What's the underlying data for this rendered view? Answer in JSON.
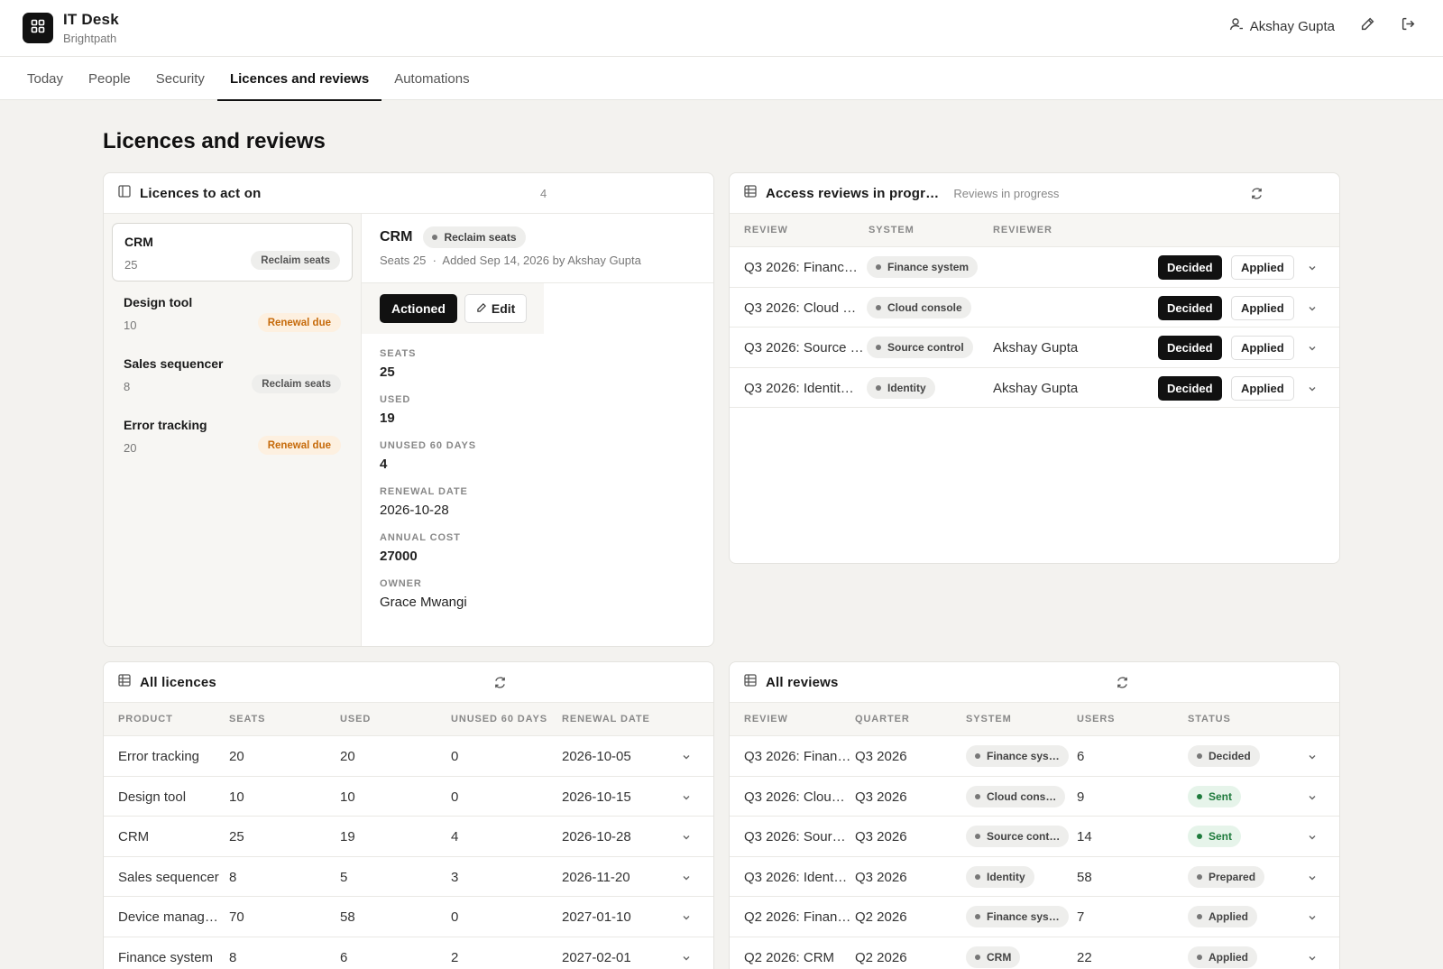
{
  "app": {
    "title": "IT Desk",
    "org": "Brightpath",
    "user": "Akshay Gupta",
    "accent": "#111111"
  },
  "icons": [
    "grid-icon",
    "user-icon",
    "pencil-icon",
    "logout-icon",
    "sidebar-panel-icon",
    "table-icon",
    "refresh-icon",
    "chevron-down-icon"
  ],
  "tabs": [
    "Today",
    "People",
    "Security",
    "Licences and reviews",
    "Automations"
  ],
  "active_tab": "Licences and reviews",
  "page_title": "Licences and reviews",
  "act_on": {
    "title": "Licences to act on",
    "count": "4",
    "items": [
      {
        "name": "CRM",
        "count": "25",
        "badge": "Reclaim seats",
        "tone": "grey"
      },
      {
        "name": "Design tool",
        "count": "10",
        "badge": "Renewal due",
        "tone": "orange"
      },
      {
        "name": "Sales sequencer",
        "count": "8",
        "badge": "Reclaim seats",
        "tone": "grey"
      },
      {
        "name": "Error tracking",
        "count": "20",
        "badge": "Renewal due",
        "tone": "orange"
      }
    ],
    "detail": {
      "name": "CRM",
      "badge": "Reclaim seats",
      "seats_meta": "Seats 25",
      "sep": "·",
      "added_meta": "Added Sep 14, 2026 by Akshay Gupta",
      "actioned_label": "Actioned",
      "edit_label": "Edit",
      "fields": [
        {
          "label": "SEATS",
          "value": "25",
          "strong": true
        },
        {
          "label": "USED",
          "value": "19",
          "strong": true
        },
        {
          "label": "UNUSED 60 DAYS",
          "value": "4",
          "strong": true
        },
        {
          "label": "RENEWAL DATE",
          "value": "2026-10-28",
          "strong": false
        },
        {
          "label": "ANNUAL COST",
          "value": "27000",
          "strong": true
        },
        {
          "label": "OWNER",
          "value": "Grace Mwangi",
          "strong": false
        }
      ]
    }
  },
  "access_reviews": {
    "title": "Access reviews in progr…",
    "subtitle": "Reviews in progress",
    "columns": [
      "REVIEW",
      "SYSTEM",
      "REVIEWER"
    ],
    "decided_label": "Decided",
    "applied_label": "Applied",
    "rows": [
      {
        "review": "Q3 2026: Financ…",
        "system": "Finance system",
        "reviewer": ""
      },
      {
        "review": "Q3 2026: Cloud …",
        "system": "Cloud console",
        "reviewer": ""
      },
      {
        "review": "Q3 2026: Source …",
        "system": "Source control",
        "reviewer": "Akshay Gupta"
      },
      {
        "review": "Q3 2026: Identit…",
        "system": "Identity",
        "reviewer": "Akshay Gupta"
      }
    ]
  },
  "all_licences": {
    "title": "All licences",
    "columns": [
      "PRODUCT",
      "SEATS",
      "USED",
      "UNUSED 60 DAYS",
      "RENEWAL DATE"
    ],
    "rows": [
      {
        "product": "Error tracking",
        "seats": "20",
        "used": "20",
        "unused": "0",
        "renewal": "2026-10-05"
      },
      {
        "product": "Design tool",
        "seats": "10",
        "used": "10",
        "unused": "0",
        "renewal": "2026-10-15"
      },
      {
        "product": "CRM",
        "seats": "25",
        "used": "19",
        "unused": "4",
        "renewal": "2026-10-28"
      },
      {
        "product": "Sales sequencer",
        "seats": "8",
        "used": "5",
        "unused": "3",
        "renewal": "2026-11-20"
      },
      {
        "product": "Device manag…",
        "seats": "70",
        "used": "58",
        "unused": "0",
        "renewal": "2027-01-10"
      },
      {
        "product": "Finance system",
        "seats": "8",
        "used": "6",
        "unused": "2",
        "renewal": "2027-02-01"
      }
    ]
  },
  "all_reviews": {
    "title": "All reviews",
    "columns": [
      "REVIEW",
      "QUARTER",
      "SYSTEM",
      "USERS",
      "STATUS"
    ],
    "rows": [
      {
        "review": "Q3 2026: Finan…",
        "quarter": "Q3 2026",
        "system": "Finance sys…",
        "users": "6",
        "status": "Decided",
        "tone": "grey"
      },
      {
        "review": "Q3 2026: Clou…",
        "quarter": "Q3 2026",
        "system": "Cloud cons…",
        "users": "9",
        "status": "Sent",
        "tone": "green"
      },
      {
        "review": "Q3 2026: Sour…",
        "quarter": "Q3 2026",
        "system": "Source cont…",
        "users": "14",
        "status": "Sent",
        "tone": "green"
      },
      {
        "review": "Q3 2026: Ident…",
        "quarter": "Q3 2026",
        "system": "Identity",
        "users": "58",
        "status": "Prepared",
        "tone": "grey"
      },
      {
        "review": "Q2 2026: Finan…",
        "quarter": "Q2 2026",
        "system": "Finance sys…",
        "users": "7",
        "status": "Applied",
        "tone": "grey"
      },
      {
        "review": "Q2 2026: CRM",
        "quarter": "Q2 2026",
        "system": "CRM",
        "users": "22",
        "status": "Applied",
        "tone": "grey"
      }
    ]
  }
}
